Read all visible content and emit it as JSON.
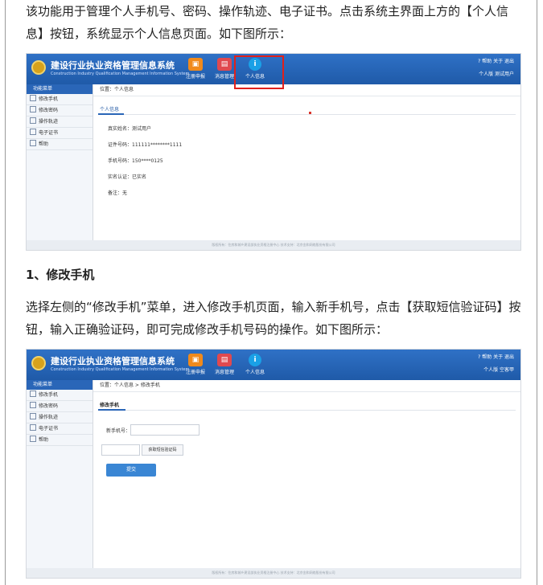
{
  "intro": {
    "text": "该功能用于管理个人手机号、密码、操作轨迹、电子证书。点击系统主界面上方的【个人信息】按钮，系统显示个人信息页面。如下图所示："
  },
  "section1": {
    "heading": "1、修改手机",
    "text": "选择左侧的“修改手机”菜单，进入修改手机页面，输入新手机号，点击【获取短信验证码】按钮，输入正确验证码，即可完成修改手机号码的操作。如下图所示："
  },
  "app": {
    "title": "建设行业执业资格管理信息系统",
    "subtitle": "Construction Industry Qualification Management Information System",
    "nav": [
      {
        "label": "注册申报",
        "icon": "register-icon",
        "color": "#f08a1c"
      },
      {
        "label": "消息管理",
        "icon": "message-icon",
        "color": "#e0494f"
      },
      {
        "label": "个人信息",
        "icon": "info-icon",
        "color": "#1aa0e6"
      }
    ],
    "top_links": "? 帮助  关于  退出",
    "sidebar_title": "功能菜单",
    "sidebar_items": [
      "修改手机",
      "修改密码",
      "操作轨迹",
      "电子证书",
      "帮助"
    ],
    "footer": "版权所有：住房和城乡建设部执业资格注册中心  技术支持：北京金和网络股份有限公司",
    "highlight_color": "#e0201b"
  },
  "screen1": {
    "user": "个人版  测试用户",
    "breadcrumb": "位置：个人信息",
    "tab": "个人信息",
    "fields": [
      {
        "label": "真实姓名：",
        "value": "测试用户"
      },
      {
        "label": "证件号码：",
        "value": "111111********1111"
      },
      {
        "label": "手机号码：",
        "value": "150****0125"
      },
      {
        "label": "实名认证：",
        "value": "已实名"
      },
      {
        "label": "备注：",
        "value": "无"
      }
    ]
  },
  "screen2": {
    "user": "个人版  空客甲",
    "breadcrumb": "位置：个人信息 > 修改手机",
    "tab": "修改手机",
    "phone_label": "新手机号：",
    "phone_placeholder": "",
    "code_placeholder": "",
    "sms_button": "获取短信验证码",
    "submit_button": "提交"
  }
}
